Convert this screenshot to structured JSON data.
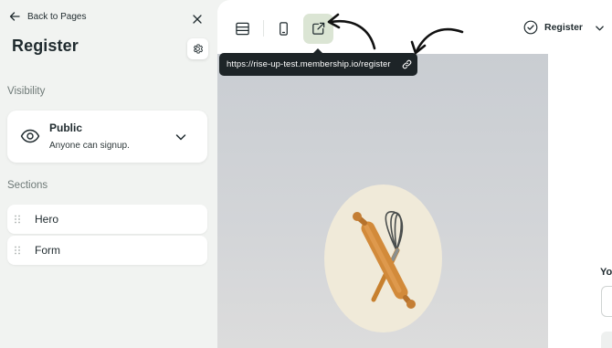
{
  "sidebar": {
    "back_label": "Back to Pages",
    "title": "Register",
    "visibility_heading": "Visibility",
    "visibility": {
      "title": "Public",
      "subtitle": "Anyone can signup."
    },
    "sections_heading": "Sections",
    "sections": [
      {
        "label": "Hero"
      },
      {
        "label": "Form"
      }
    ]
  },
  "toolbar": {
    "buttons": [
      "desktop-view-icon",
      "mobile-view-icon",
      "open-external-icon"
    ],
    "active_button": "open-external-icon",
    "status": "Register"
  },
  "tooltip": {
    "url": "https://rise-up-test.membership.io/register"
  },
  "preview": {
    "form_label_partial": "Yo"
  },
  "colors": {
    "accent_active": "#dbe5d4",
    "tooltip_bg": "#1d2427",
    "sidebar_bg": "#f1f3f1"
  }
}
